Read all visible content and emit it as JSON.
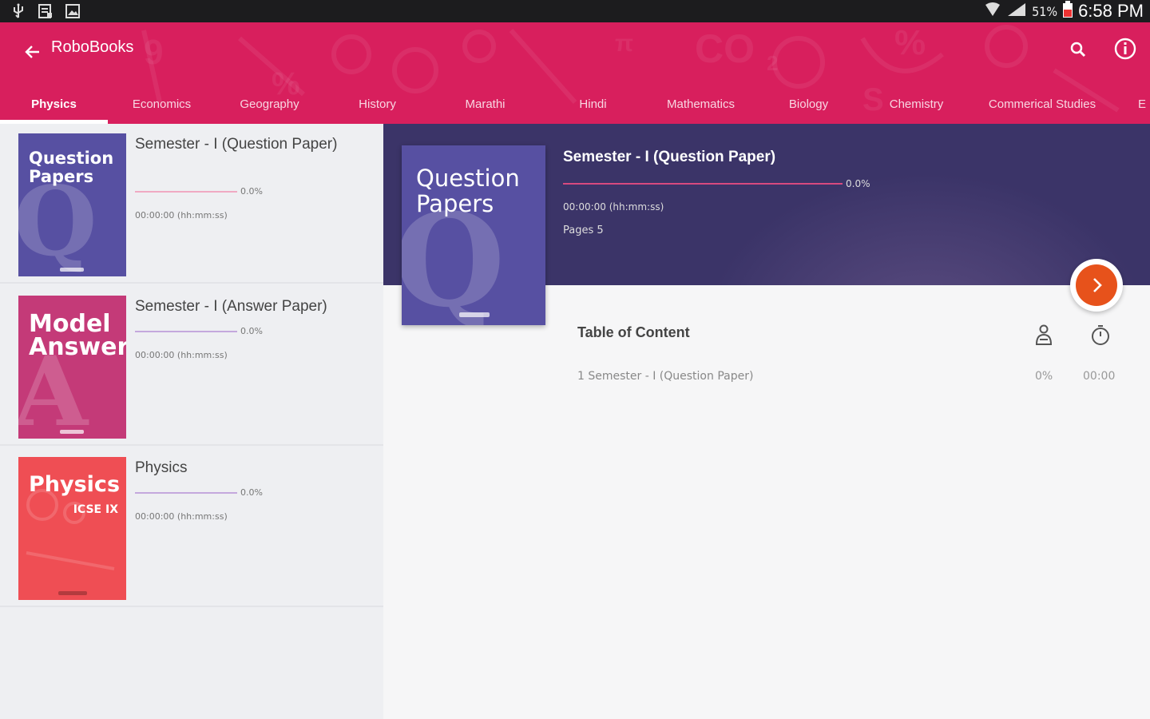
{
  "status_bar": {
    "battery": "51%",
    "time": "6:58 PM"
  },
  "app_bar": {
    "title": "RoboBooks",
    "background_color": "#d81f5d",
    "tabs": [
      {
        "label": "Physics",
        "active": true
      },
      {
        "label": "Economics"
      },
      {
        "label": "Geography"
      },
      {
        "label": "History"
      },
      {
        "label": "Marathi"
      },
      {
        "label": "Hindi"
      },
      {
        "label": "Mathematics"
      },
      {
        "label": "Biology"
      },
      {
        "label": "Chemistry"
      },
      {
        "label": "Commerical Studies"
      },
      {
        "label": "E"
      }
    ]
  },
  "book_list": [
    {
      "cover_title": "Question Papers",
      "cover_letter": "Q",
      "cover_color": "#5750a2",
      "title": "Semester - I (Question Paper)",
      "progress": "0.0%",
      "progress_value": 0.0,
      "time": "00:00:00 (hh:mm:ss)"
    },
    {
      "cover_title": "Model Answers",
      "cover_letter": "A",
      "cover_color": "#c43a78",
      "title": "Semester - I (Answer Paper)",
      "progress": "0.0%",
      "progress_value": 0.0,
      "time": "00:00:00 (hh:mm:ss)"
    },
    {
      "cover_title": "Physics",
      "cover_subtitle": "ICSE IX",
      "cover_color": "#ef4e54",
      "title": "Physics",
      "progress": "0.0%",
      "progress_value": 0.0,
      "time": "00:00:00 (hh:mm:ss)"
    }
  ],
  "detail": {
    "cover_title": "Question Papers",
    "cover_letter": "Q",
    "title": "Semester - I (Question Paper)",
    "progress": "0.0%",
    "progress_value": 0.0,
    "time": "00:00:00 (hh:mm:ss)",
    "pages": "Pages 5",
    "header_color": "#3b3468",
    "fab_color": "#e7521b"
  },
  "table_of_content": {
    "heading": "Table of Content",
    "rows": [
      {
        "label": "1 Semester - I (Question Paper)",
        "percent": "0%",
        "time": "00:00"
      }
    ]
  }
}
